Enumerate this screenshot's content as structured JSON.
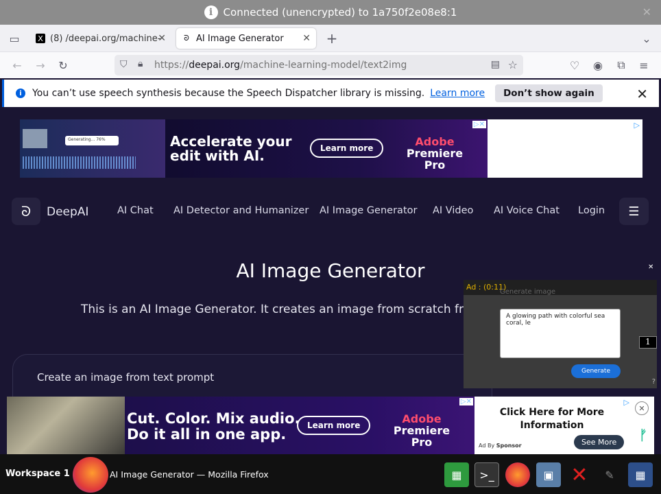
{
  "connection_bar": {
    "text": "Connected (unencrypted) to 1a750f2e08e8:1"
  },
  "tabs": [
    {
      "label": "(8) /deepai.org/machine-",
      "favicon": "x-logo-icon"
    },
    {
      "label": "AI Image Generator",
      "favicon": "deepai-logo-icon"
    }
  ],
  "url": {
    "prefix": "https://",
    "domain": "deepai.org",
    "path": "/machine-learning-model/text2img"
  },
  "notification": {
    "message": "You can’t use speech synthesis because the Speech Dispatcher library is missing.",
    "learn_more": "Learn more",
    "dont_show": "Don’t show again"
  },
  "top_ad": {
    "headline_1": "Accelerate your",
    "headline_2": "edit with AI.",
    "cta": "Learn more",
    "brand_1": "Adobe",
    "brand_2": "Premiere Pro",
    "thumb_text": "Generating...  76%"
  },
  "site_nav": {
    "brand": "DeepAI",
    "items": [
      "AI Chat",
      "AI Detector and Humanizer",
      "AI Image Generator",
      "AI Video",
      "AI Voice Chat",
      "Login"
    ]
  },
  "main": {
    "title": "AI Image Generator",
    "description": "This is an AI Image Generator. It creates an image from scratch fro",
    "card_title": "Create an image from text prompt"
  },
  "video_ad": {
    "timer": "Ad : (0:11)",
    "header": "Generate image",
    "prompt": "A glowing path with colorful sea coral, le",
    "button": "Generate",
    "counter": "1"
  },
  "bottom_ad": {
    "headline_1": "Cut. Color. Mix audio.",
    "headline_2": "Do it all in one app.",
    "cta": "Learn more",
    "brand_1": "Adobe",
    "brand_2": "Premiere Pro",
    "side_text": "Click Here for More Information",
    "sponsor": "Ad By",
    "sponsor_strong": "Sponsor",
    "see_more": "See More"
  },
  "taskbar": {
    "workspace": "Workspace 1",
    "window_title": "AI Image Generator — Mozilla Firefox"
  }
}
